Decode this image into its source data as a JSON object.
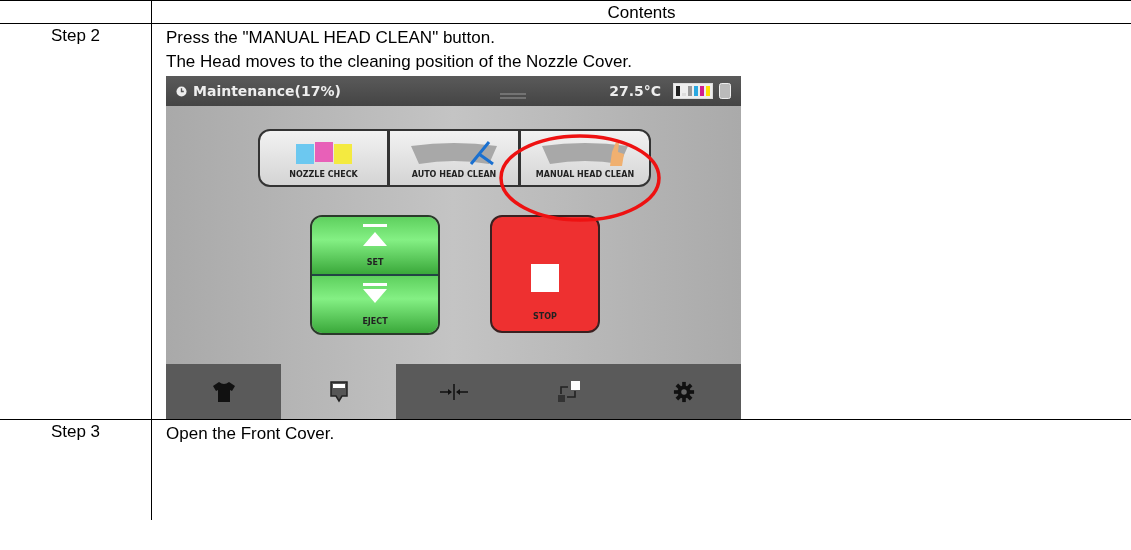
{
  "table": {
    "header": "Contents",
    "rows": [
      {
        "step": "Step 2",
        "lines": [
          "Press the \"MANUAL HEAD CLEAN\" button.",
          "The Head moves to the cleaning position of the Nozzle Cover."
        ],
        "device_screen": {
          "title": "Maintenance(17%)",
          "temperature": "27.5°C",
          "mode_buttons": [
            {
              "kind": "stripes",
              "label": "NOZZLE CHECK",
              "circled": false
            },
            {
              "kind": "wiper",
              "label": "AUTO HEAD CLEAN",
              "circled": false
            },
            {
              "kind": "hand",
              "label": "MANUAL HEAD CLEAN",
              "circled": true
            }
          ],
          "action_buttons": [
            {
              "kind": "set",
              "label": "SET"
            },
            {
              "kind": "eject",
              "label": "EJECT"
            },
            {
              "kind": "stop",
              "label": "STOP"
            }
          ],
          "tabs": [
            {
              "kind": "shirt",
              "selected": false
            },
            {
              "kind": "ink",
              "selected": true
            },
            {
              "kind": "align",
              "selected": false
            },
            {
              "kind": "swap",
              "selected": false
            },
            {
              "kind": "gear",
              "selected": false
            }
          ]
        }
      },
      {
        "step": "Step 3",
        "lines": [
          "Open the Front Cover."
        ]
      }
    ]
  }
}
